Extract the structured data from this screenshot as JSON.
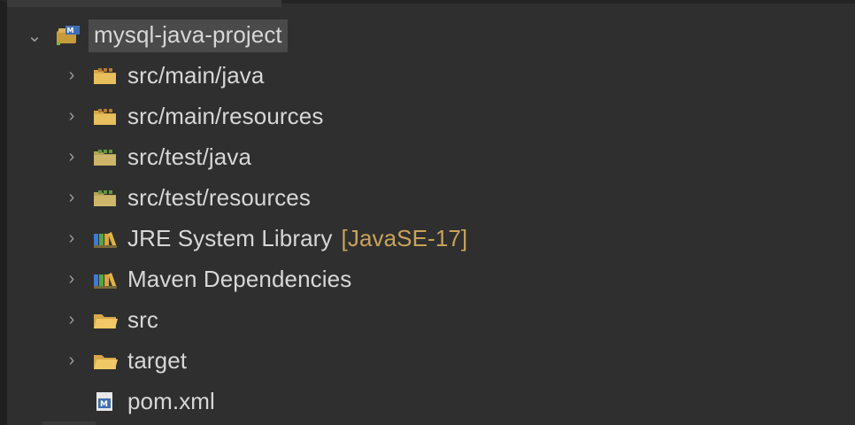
{
  "project_explorer": {
    "root": {
      "label": "mysql-java-project",
      "icon": "maven-project-icon",
      "expanded": true
    },
    "items": [
      {
        "label": "src/main/java",
        "icon": "source-folder-icon",
        "expandable": true
      },
      {
        "label": "src/main/resources",
        "icon": "source-folder-icon",
        "expandable": true
      },
      {
        "label": "src/test/java",
        "icon": "test-source-folder-icon",
        "expandable": true
      },
      {
        "label": "src/test/resources",
        "icon": "test-source-folder-icon",
        "expandable": true
      },
      {
        "label": "JRE System Library",
        "decoration": "[JavaSE-17]",
        "icon": "library-icon",
        "expandable": true
      },
      {
        "label": "Maven Dependencies",
        "icon": "library-icon",
        "expandable": true
      },
      {
        "label": "src",
        "icon": "folder-icon",
        "expandable": true
      },
      {
        "label": "target",
        "icon": "folder-icon",
        "expandable": true
      },
      {
        "label": "pom.xml",
        "icon": "maven-pom-file-icon",
        "expandable": false
      }
    ]
  },
  "colors": {
    "background": "#2f2f2f",
    "text": "#d7d7d7",
    "decoration": "#c8a35a",
    "selection": "#4a4a4a"
  }
}
